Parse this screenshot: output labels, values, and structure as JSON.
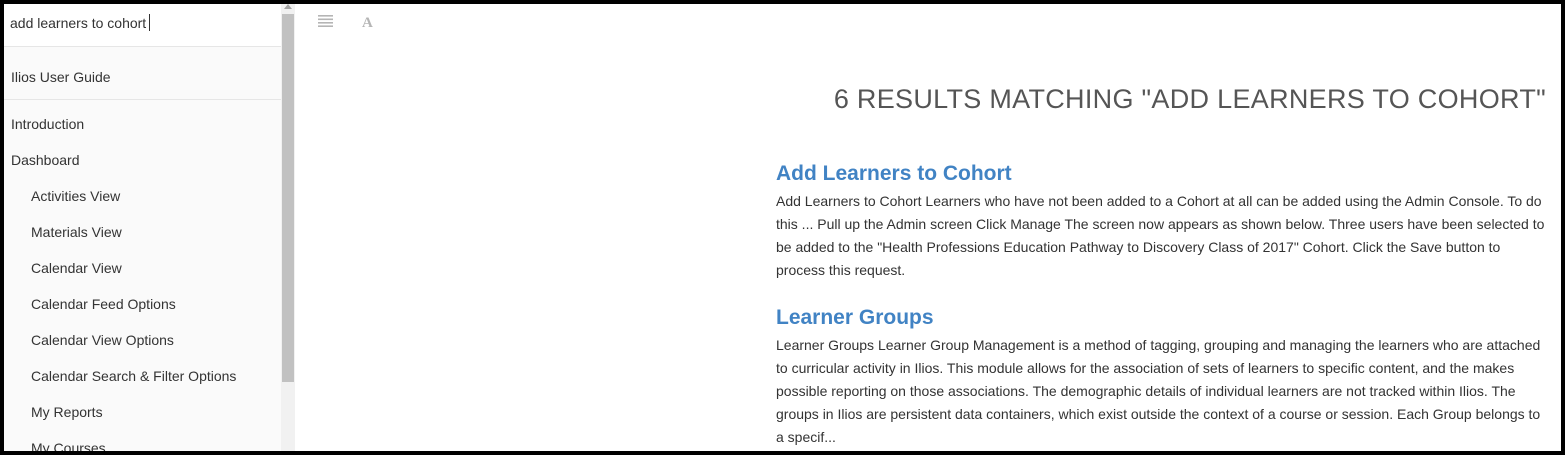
{
  "search": {
    "value": "add learners to cohort"
  },
  "sidebar": {
    "book_title": "Ilios User Guide",
    "items": [
      {
        "label": "Introduction",
        "level": 1
      },
      {
        "label": "Dashboard",
        "level": 1
      },
      {
        "label": "Activities View",
        "level": 2
      },
      {
        "label": "Materials View",
        "level": 2
      },
      {
        "label": "Calendar View",
        "level": 2
      },
      {
        "label": "Calendar Feed Options",
        "level": 2
      },
      {
        "label": "Calendar View Options",
        "level": 2
      },
      {
        "label": "Calendar Search & Filter Options",
        "level": 2
      },
      {
        "label": "My Reports",
        "level": 2
      },
      {
        "label": "My Courses",
        "level": 2
      }
    ]
  },
  "toolbar": {
    "menu_icon": "menu-icon",
    "font_icon": "font-settings-icon",
    "font_glyph": "A"
  },
  "main": {
    "results_heading": "6 RESULTS MATCHING \"ADD LEARNERS TO COHORT\"",
    "results": [
      {
        "title": "Add Learners to Cohort",
        "snippet": "Add Learners to Cohort Learners who have not been added to a Cohort at all can be added using the Admin Console. To do this ... Pull up the Admin screen Click Manage The screen now appears as shown below. Three users have been selected to be added to the \"Health Professions Education Pathway to Discovery Class of 2017\" Cohort. Click the Save button to process this request."
      },
      {
        "title": "Learner Groups",
        "snippet": "Learner Groups Learner Group Management is a method of tagging, grouping and managing the learners who are attached to curricular activity in Ilios. This module allows for the association of sets of learners to specific content, and the makes possible reporting on those associations. The demographic details of individual learners are not tracked within Ilios. The groups in Ilios are persistent data containers, which exist outside the context of a course or session. Each Group belongs to a specif..."
      }
    ]
  },
  "colors": {
    "link": "#4183c4",
    "heading": "#555555",
    "text": "#333333"
  }
}
